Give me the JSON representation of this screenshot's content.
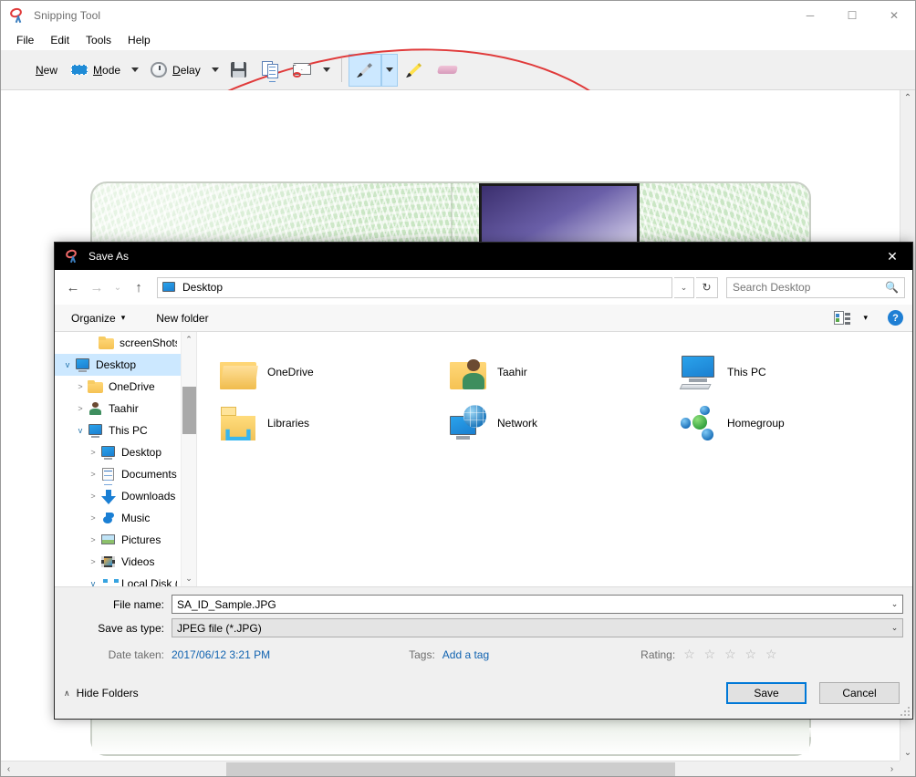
{
  "app": {
    "title": "Snipping Tool",
    "icon": "snipping-tool-icon",
    "window_controls": {
      "minimize": "─",
      "maximize": "☐",
      "close": "✕"
    },
    "menu": [
      {
        "label": "File"
      },
      {
        "label": "Edit"
      },
      {
        "label": "Tools"
      },
      {
        "label": "Help"
      }
    ],
    "toolbar": [
      {
        "name": "new-button",
        "label": "New",
        "underline": "N",
        "icon": "scissors-icon",
        "has_arrow": false
      },
      {
        "name": "mode-button",
        "label": "Mode",
        "underline": "M",
        "icon": "mode-icon",
        "has_arrow": true
      },
      {
        "name": "delay-button",
        "label": "Delay",
        "underline": "D",
        "icon": "clock-icon",
        "has_arrow": true
      },
      {
        "name": "save-snip-button",
        "label": "",
        "underline": "",
        "icon": "floppy-disk-icon",
        "has_arrow": false
      },
      {
        "name": "copy-button",
        "label": "",
        "underline": "",
        "icon": "copy-icon",
        "has_arrow": false
      },
      {
        "name": "email-button",
        "label": "",
        "underline": "",
        "icon": "envelope-icon",
        "has_arrow": true
      },
      {
        "name": "pen-button",
        "label": "",
        "underline": "",
        "icon": "pen-icon",
        "has_arrow": true,
        "active": true
      },
      {
        "name": "highlighter-button",
        "label": "",
        "underline": "",
        "icon": "highlighter-icon",
        "has_arrow": false
      },
      {
        "name": "eraser-button",
        "label": "",
        "underline": "",
        "icon": "eraser-icon",
        "has_arrow": false
      }
    ]
  },
  "dialog": {
    "title": "Save As",
    "icon": "snipping-tool-icon",
    "close_glyph": "✕",
    "nav": {
      "back_glyph": "←",
      "forward_glyph": "→",
      "recent_glyph": "⌄",
      "up_glyph": "↑",
      "address_value": "Desktop",
      "address_icon": "desktop-icon",
      "address_caret": "⌄",
      "refresh_glyph": "↻"
    },
    "search": {
      "placeholder": "Search Desktop",
      "icon": "search-icon"
    },
    "commandbar": {
      "organize_label": "Organize",
      "organize_caret": "▾",
      "new_folder_label": "New folder",
      "view_caret": "▾",
      "help_label": "?"
    },
    "tree": [
      {
        "label": "screenShots",
        "icon": "folder-icon",
        "indent": 2,
        "twisty": "",
        "selected": false
      },
      {
        "label": "Desktop",
        "icon": "desktop-icon",
        "indent": 0,
        "twisty": "v",
        "selected": true
      },
      {
        "label": "OneDrive",
        "icon": "folder-icon",
        "indent": 1,
        "twisty": ">",
        "selected": false
      },
      {
        "label": "Taahir",
        "icon": "user-icon",
        "indent": 1,
        "twisty": ">",
        "selected": false
      },
      {
        "label": "This PC",
        "icon": "thispc-icon",
        "indent": 1,
        "twisty": "v",
        "selected": false
      },
      {
        "label": "Desktop",
        "icon": "desktop-icon",
        "indent": 2,
        "twisty": ">",
        "selected": false
      },
      {
        "label": "Documents",
        "icon": "documents-icon",
        "indent": 2,
        "twisty": ">",
        "selected": false
      },
      {
        "label": "Downloads",
        "icon": "downloads-icon",
        "indent": 2,
        "twisty": ">",
        "selected": false
      },
      {
        "label": "Music",
        "icon": "music-icon",
        "indent": 2,
        "twisty": ">",
        "selected": false
      },
      {
        "label": "Pictures",
        "icon": "pictures-icon",
        "indent": 2,
        "twisty": ">",
        "selected": false
      },
      {
        "label": "Videos",
        "icon": "videos-icon",
        "indent": 2,
        "twisty": ">",
        "selected": false
      },
      {
        "label": "Local Disk (C:)",
        "icon": "disk-icon",
        "indent": 2,
        "twisty": "v",
        "selected": false
      }
    ],
    "files": [
      {
        "label": "OneDrive",
        "icon": "folder-icon"
      },
      {
        "label": "Taahir",
        "icon": "user-folder-icon"
      },
      {
        "label": "This PC",
        "icon": "thispc-icon"
      },
      {
        "label": "Libraries",
        "icon": "libraries-icon"
      },
      {
        "label": "Network",
        "icon": "network-icon"
      },
      {
        "label": "Homegroup",
        "icon": "homegroup-icon"
      }
    ],
    "form": {
      "file_name_label": "File name:",
      "file_name_value": "SA_ID_Sample.JPG",
      "save_as_type_label": "Save as type:",
      "save_as_type_value": "JPEG file (*.JPG)",
      "combo_caret": "⌄"
    },
    "metadata": {
      "date_taken_label": "Date taken:",
      "date_taken_value": "2017/06/12 3:21 PM",
      "tags_label": "Tags:",
      "tags_value": "Add a tag",
      "rating_label": "Rating:",
      "rating_stars": "☆ ☆ ☆ ☆ ☆",
      "rating_value": 0
    },
    "footer": {
      "hide_folders_label": "Hide Folders",
      "hide_folders_chevron": "∧",
      "save_label": "Save",
      "cancel_label": "Cancel"
    }
  },
  "canvas": {
    "scroll_up": "⌃",
    "scroll_down": "⌄",
    "scroll_left": "‹",
    "scroll_right": "›"
  },
  "colors": {
    "accent": "#0078d7",
    "selection": "#cce8ff",
    "dialog_titlebar": "#000000",
    "link": "#0f62b0",
    "chrome": "#f0f0f0"
  }
}
